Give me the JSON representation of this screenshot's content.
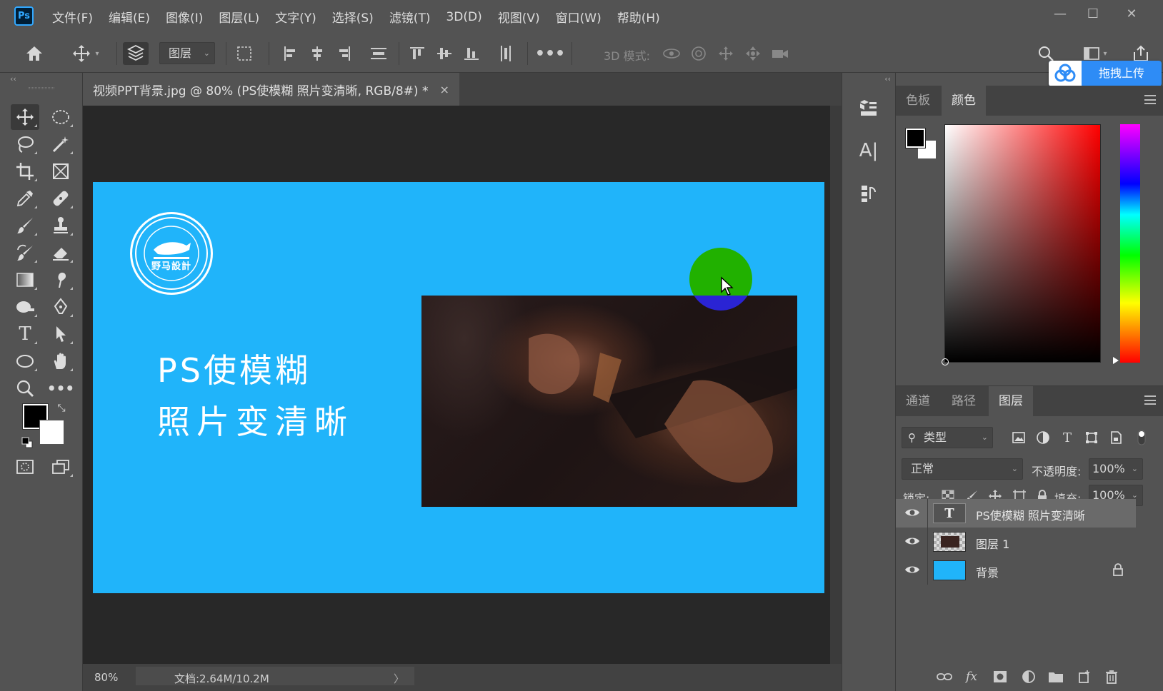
{
  "app": {
    "logo_text": "Ps",
    "menu": [
      "文件(F)",
      "编辑(E)",
      "图像(I)",
      "图层(L)",
      "文字(Y)",
      "选择(S)",
      "滤镜(T)",
      "3D(D)",
      "视图(V)",
      "窗口(W)",
      "帮助(H)"
    ],
    "window_controls": {
      "minimize": "—",
      "maximize": "☐",
      "close": "✕"
    }
  },
  "options_bar": {
    "auto_select_value": "图层",
    "mode_3d_label": "3D 模式:",
    "upload_label": "拖拽上传"
  },
  "document": {
    "tab_title": "视频PPT背景.jpg @ 80% (PS使模糊 照片变清晰, RGB/8#) *",
    "close_glyph": "×",
    "zoom": "80%",
    "doc_info": "文档:2.64M/10.2M",
    "status_arrow": "〉",
    "canvas": {
      "background_color": "#20b4fa",
      "headline_line1": "PS使模糊",
      "headline_line2": "照片变清晰",
      "seal_text": "野马設計"
    }
  },
  "color_panel": {
    "tabs": [
      "色板",
      "颜色"
    ],
    "active_tab": "颜色",
    "foreground": "#000000",
    "background": "#ffffff"
  },
  "layers_panel": {
    "tabs": [
      "通道",
      "路径",
      "图层"
    ],
    "active_tab": "图层",
    "filter_label": "类型",
    "blend_mode": "正常",
    "opacity_label": "不透明度:",
    "opacity_value": "100%",
    "lock_label": "锁定:",
    "fill_label": "填充:",
    "fill_value": "100%",
    "layers": [
      {
        "name": "PS使模糊 照片变清晰",
        "kind": "text",
        "selected": true,
        "locked": false
      },
      {
        "name": "图层 1",
        "kind": "image",
        "selected": false,
        "locked": false
      },
      {
        "name": "背景",
        "kind": "background",
        "selected": false,
        "locked": true
      }
    ]
  },
  "colors": {
    "ui_dark": "#535353",
    "canvas_bg": "#282828",
    "accent_blue": "#2e8cf6"
  }
}
